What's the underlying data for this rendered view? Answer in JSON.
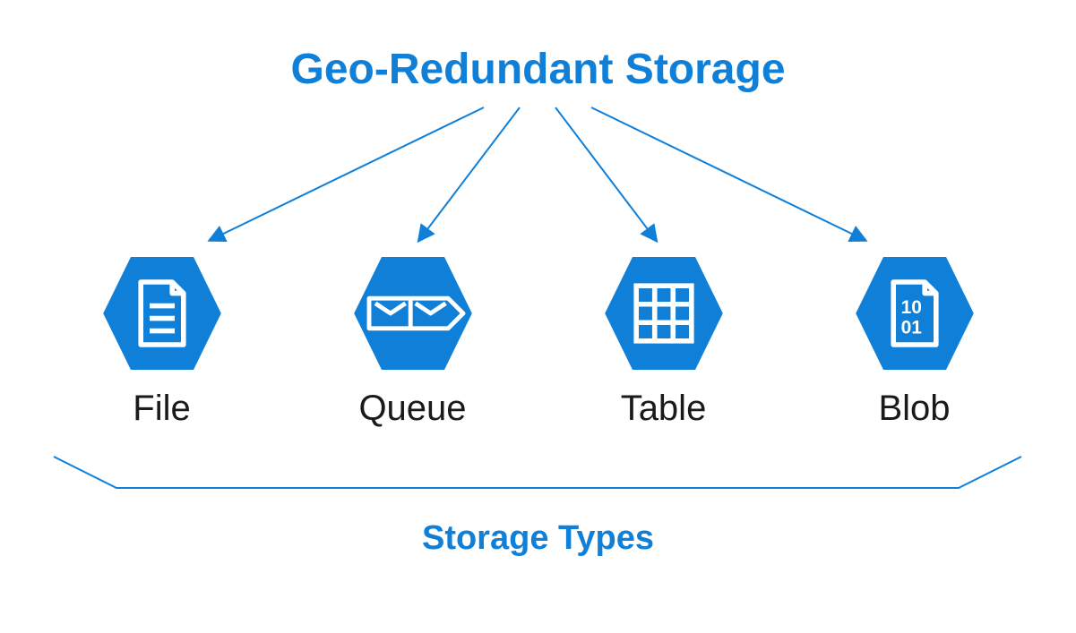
{
  "title": "Geo-Redundant Storage",
  "footer": "Storage Types",
  "colors": {
    "accent": "#0f7fd8",
    "hex_fill": "#0f7fd8",
    "icon_stroke": "#ffffff",
    "text": "#1a1a1a"
  },
  "nodes": [
    {
      "label": "File",
      "icon": "file-icon"
    },
    {
      "label": "Queue",
      "icon": "queue-icon"
    },
    {
      "label": "Table",
      "icon": "table-icon"
    },
    {
      "label": "Blob",
      "icon": "blob-icon"
    }
  ]
}
